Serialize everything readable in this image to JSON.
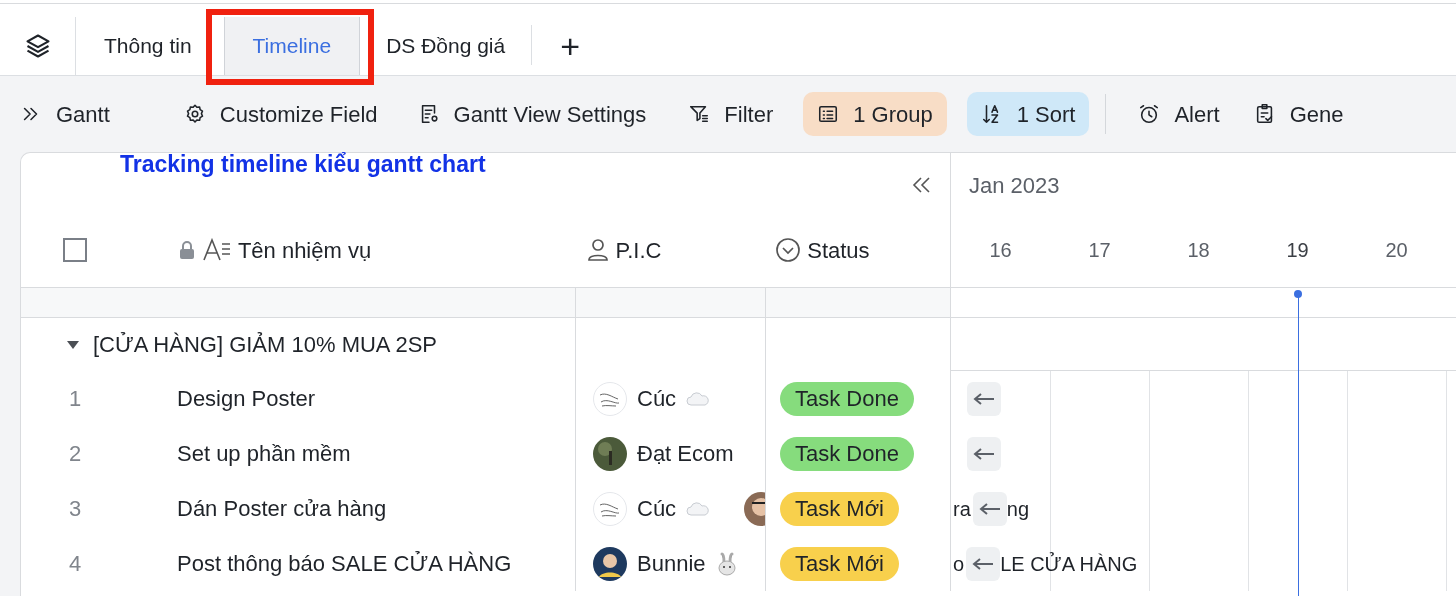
{
  "tabs": [
    {
      "label": "Thông tin",
      "selected": false,
      "highlighted": false
    },
    {
      "label": "Timeline",
      "selected": true,
      "highlighted": true
    },
    {
      "label": "DS Đồng giá",
      "selected": false,
      "highlighted": false
    }
  ],
  "add_tab": "+",
  "annotations": {
    "note": "Tracking timeline kiểu gantt chart"
  },
  "toolbar": [
    {
      "kind": "gantt",
      "label": "Gantt"
    },
    {
      "kind": "gear",
      "label": "Customize Field"
    },
    {
      "kind": "settings",
      "label": "Gantt View Settings"
    },
    {
      "kind": "filter",
      "label": "Filter"
    },
    {
      "kind": "group",
      "label": "1 Group"
    },
    {
      "kind": "sort",
      "label": "1 Sort"
    },
    {
      "kind": "divider"
    },
    {
      "kind": "alert",
      "label": "Alert"
    },
    {
      "kind": "generate",
      "label": "Gene"
    }
  ],
  "table": {
    "checked": false,
    "columns": [
      "Tên nhiệm vụ",
      "P.I.C",
      "Status"
    ],
    "group": {
      "label": "[CỬA HÀNG] GIẢM 10% MUA 2SP",
      "expanded": true
    },
    "rows": [
      {
        "number": "1",
        "task": "Design Poster",
        "pic": {
          "name": "Cúc",
          "avatar": {
            "kind": "sketch"
          },
          "emoji": {
            "kind": "cloud"
          }
        },
        "extra_avatar": false,
        "status": {
          "label": "Task Done",
          "color": "#86dc7d"
        },
        "bar_text_before": "",
        "bar_text_after": ""
      },
      {
        "number": "2",
        "task": "Set up phần mềm",
        "pic": {
          "name": "Đạt Ecom",
          "avatar": {
            "kind": "photo"
          }
        },
        "extra_avatar": false,
        "status": {
          "label": "Task Done",
          "color": "#86dc7d"
        },
        "bar_text_before": "",
        "bar_text_after": ""
      },
      {
        "number": "3",
        "task": "Dán Poster cửa hàng",
        "pic": {
          "name": "Cúc",
          "avatar": {
            "kind": "sketch"
          },
          "emoji": {
            "kind": "cloud"
          }
        },
        "extra_avatar": true,
        "status": {
          "label": "Task Mới",
          "color": "#f8d04c"
        },
        "bar_text_before": "ra",
        "bar_text_after": "ng"
      },
      {
        "number": "4",
        "task": "Post thông báo SALE CỬA HÀNG",
        "pic": {
          "name": "Bunnie",
          "avatar": {
            "kind": "portrait"
          },
          "emoji": {
            "kind": "rabbit"
          }
        },
        "extra_avatar": false,
        "status": {
          "label": "Task Mới",
          "color": "#f8d04c"
        },
        "bar_text_before": "o",
        "bar_text_after": "LE CỬA HÀNG"
      }
    ]
  },
  "timeline": {
    "month": "Jan 2023",
    "days": [
      {
        "label": "16",
        "today": false
      },
      {
        "label": "17",
        "today": false
      },
      {
        "label": "18",
        "today": false
      },
      {
        "label": "19",
        "today": true
      },
      {
        "label": "20",
        "today": false
      }
    ]
  }
}
